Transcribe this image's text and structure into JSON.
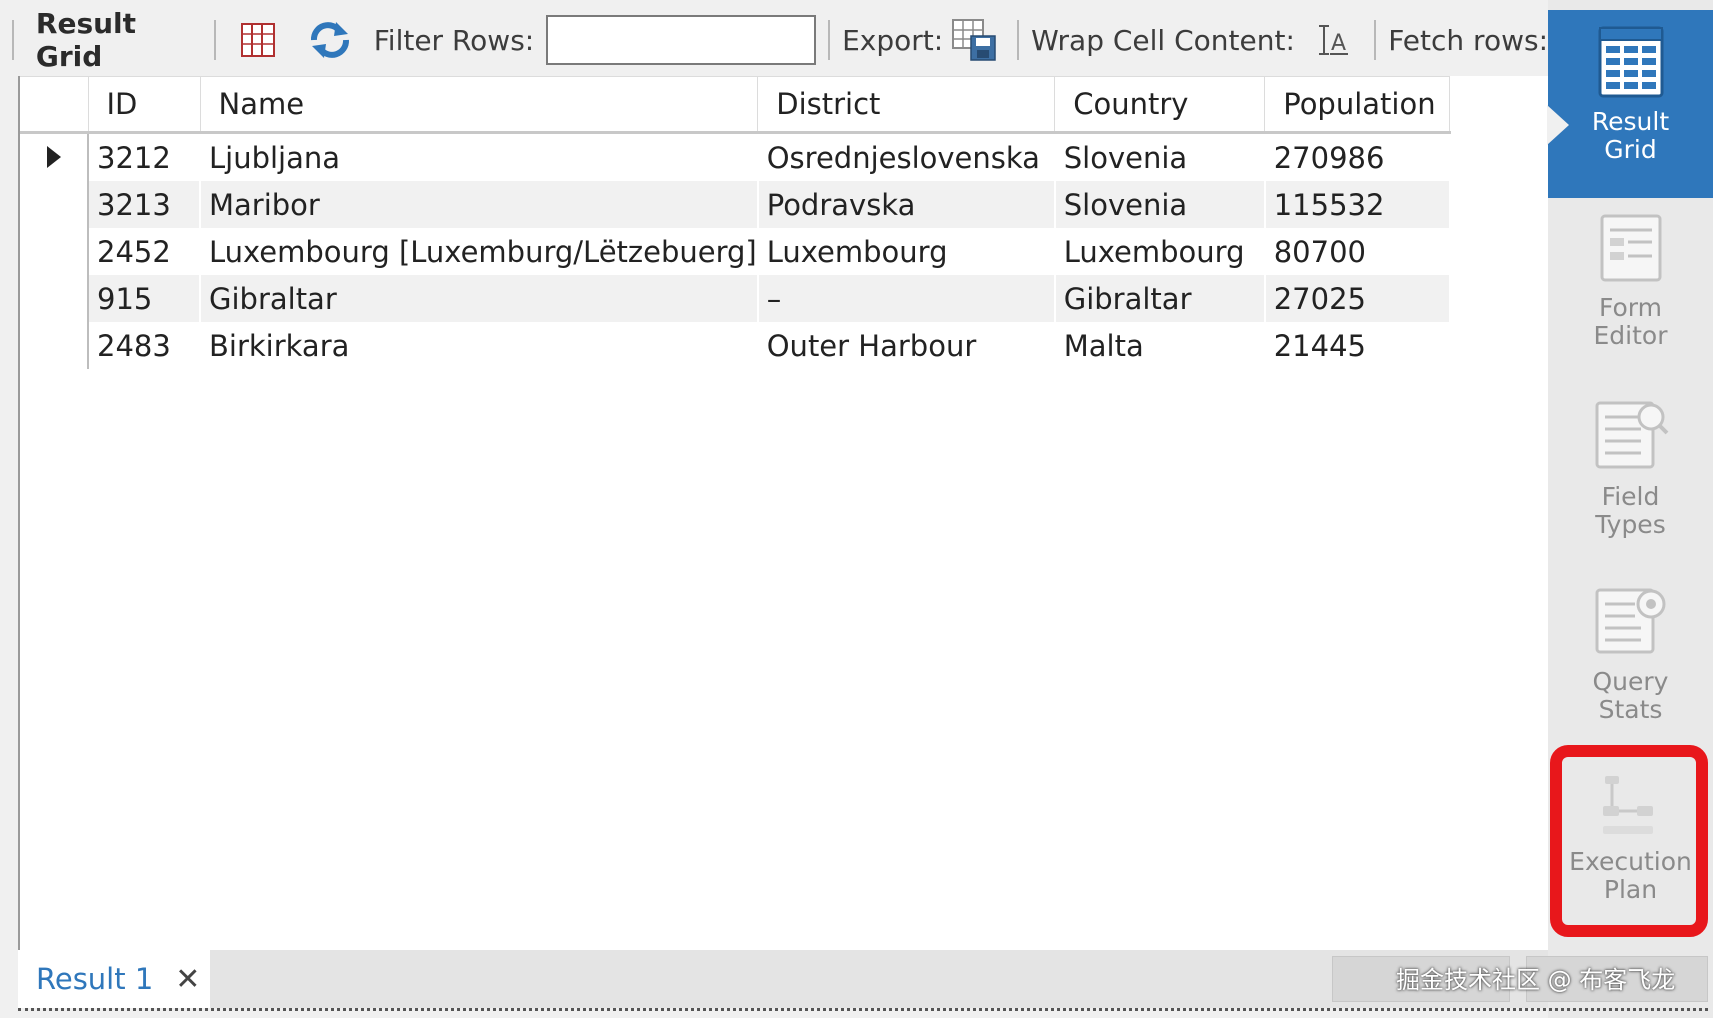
{
  "toolbar": {
    "title": "Result Grid",
    "filter_label": "Filter Rows:",
    "filter_value": "",
    "export_label": "Export:",
    "wrap_label": "Wrap Cell Content:",
    "fetch_label": "Fetch rows:"
  },
  "grid": {
    "columns": [
      "ID",
      "Name",
      "District",
      "Country",
      "Population"
    ],
    "rows": [
      [
        "3212",
        "Ljubljana",
        "Osrednjeslovenska",
        "Slovenia",
        "270986"
      ],
      [
        "3213",
        "Maribor",
        "Podravska",
        "Slovenia",
        "115532"
      ],
      [
        "2452",
        "Luxembourg [Luxemburg/Lëtzebuerg]",
        "Luxembourg",
        "Luxembourg",
        "80700"
      ],
      [
        "915",
        "Gibraltar",
        "–",
        "Gibraltar",
        "27025"
      ],
      [
        "2483",
        "Birkirkara",
        "Outer Harbour",
        "Malta",
        "21445"
      ]
    ],
    "selected_row": 0
  },
  "sidepanel": {
    "result_grid": "Result\nGrid",
    "form_editor": "Form\nEditor",
    "field_types": "Field\nTypes",
    "query_stats": "Query\nStats",
    "execution_plan": "Execution\nPlan"
  },
  "bottom": {
    "tab_label": "Result 1",
    "close_symbol": "✕"
  },
  "watermark": "掘金技术社区 @ 布客飞龙",
  "colors": {
    "accent": "#2f77bb",
    "highlight": "#e8171b"
  }
}
